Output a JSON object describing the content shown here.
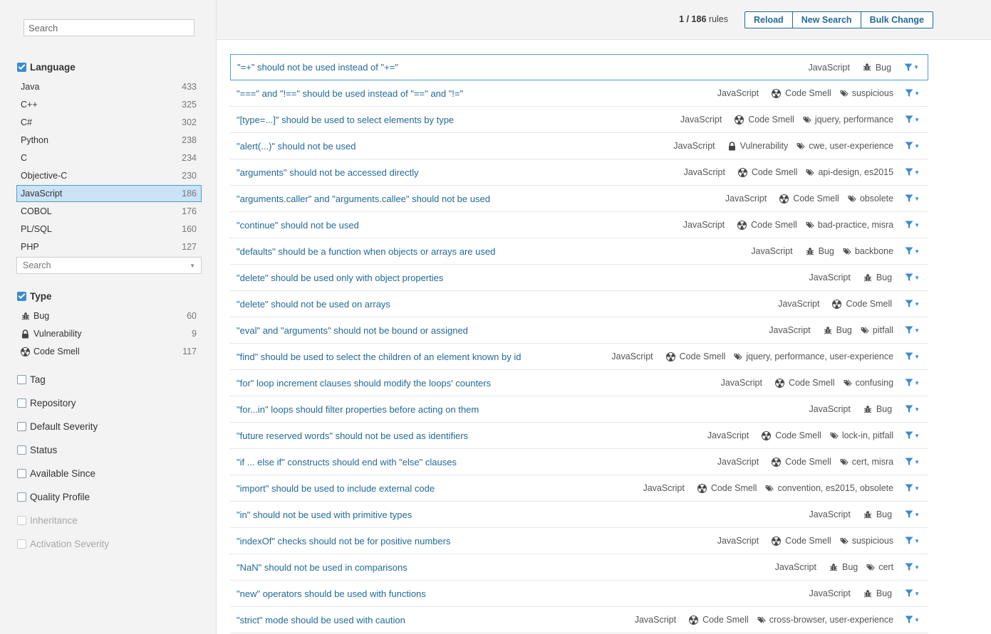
{
  "sidebar": {
    "search_placeholder": "Search",
    "language": {
      "title": "Language",
      "items": [
        {
          "label": "Java",
          "count": "433"
        },
        {
          "label": "C++",
          "count": "325"
        },
        {
          "label": "C#",
          "count": "302"
        },
        {
          "label": "Python",
          "count": "238"
        },
        {
          "label": "C",
          "count": "234"
        },
        {
          "label": "Objective-C",
          "count": "230"
        },
        {
          "label": "JavaScript",
          "count": "186"
        },
        {
          "label": "COBOL",
          "count": "176"
        },
        {
          "label": "PL/SQL",
          "count": "160"
        },
        {
          "label": "PHP",
          "count": "127"
        }
      ],
      "select_placeholder": "Search"
    },
    "type": {
      "title": "Type",
      "items": [
        {
          "label": "Bug",
          "count": "60",
          "icon": "bug-icon"
        },
        {
          "label": "Vulnerability",
          "count": "9",
          "icon": "lock-icon"
        },
        {
          "label": "Code Smell",
          "count": "117",
          "icon": "radiation-icon"
        }
      ]
    },
    "facets": {
      "tag": "Tag",
      "repository": "Repository",
      "default_severity": "Default Severity",
      "status": "Status",
      "available_since": "Available Since",
      "quality_profile": "Quality Profile",
      "inheritance": "Inheritance",
      "activation_severity": "Activation Severity"
    }
  },
  "topbar": {
    "counter_current": "1",
    "counter_total": "/ 186",
    "counter_suffix": "rules",
    "reload": "Reload",
    "new_search": "New Search",
    "bulk_change": "Bulk Change"
  },
  "rules": [
    {
      "name": "\"=+\" should not be used instead of \"+=\"",
      "lang": "JavaScript",
      "type": "Bug",
      "tags": ""
    },
    {
      "name": "\"===\" and \"!==\" should be used instead of \"==\" and \"!=\"",
      "lang": "JavaScript",
      "type": "Code Smell",
      "tags": "suspicious"
    },
    {
      "name": "\"[type=...]\" should be used to select elements by type",
      "lang": "JavaScript",
      "type": "Code Smell",
      "tags": "jquery, performance"
    },
    {
      "name": "\"alert(...)\" should not be used",
      "lang": "JavaScript",
      "type": "Vulnerability",
      "tags": "cwe, user-experience"
    },
    {
      "name": "\"arguments\" should not be accessed directly",
      "lang": "JavaScript",
      "type": "Code Smell",
      "tags": "api-design, es2015"
    },
    {
      "name": "\"arguments.caller\" and \"arguments.callee\" should not be used",
      "lang": "JavaScript",
      "type": "Code Smell",
      "tags": "obsolete"
    },
    {
      "name": "\"continue\" should not be used",
      "lang": "JavaScript",
      "type": "Code Smell",
      "tags": "bad-practice, misra"
    },
    {
      "name": "\"defaults\" should be a function when objects or arrays are used",
      "lang": "JavaScript",
      "type": "Bug",
      "tags": "backbone"
    },
    {
      "name": "\"delete\" should be used only with object properties",
      "lang": "JavaScript",
      "type": "Bug",
      "tags": ""
    },
    {
      "name": "\"delete\" should not be used on arrays",
      "lang": "JavaScript",
      "type": "Code Smell",
      "tags": ""
    },
    {
      "name": "\"eval\" and \"arguments\" should not be bound or assigned",
      "lang": "JavaScript",
      "type": "Bug",
      "tags": "pitfall"
    },
    {
      "name": "\"find\" should be used to select the children of an element known by id",
      "lang": "JavaScript",
      "type": "Code Smell",
      "tags": "jquery, performance, user-experience"
    },
    {
      "name": "\"for\" loop increment clauses should modify the loops' counters",
      "lang": "JavaScript",
      "type": "Code Smell",
      "tags": "confusing"
    },
    {
      "name": "\"for...in\" loops should filter properties before acting on them",
      "lang": "JavaScript",
      "type": "Bug",
      "tags": ""
    },
    {
      "name": "\"future reserved words\" should not be used as identifiers",
      "lang": "JavaScript",
      "type": "Code Smell",
      "tags": "lock-in, pitfall"
    },
    {
      "name": "\"if ... else if\" constructs should end with \"else\" clauses",
      "lang": "JavaScript",
      "type": "Code Smell",
      "tags": "cert, misra"
    },
    {
      "name": "\"import\" should be used to include external code",
      "lang": "JavaScript",
      "type": "Code Smell",
      "tags": "convention, es2015, obsolete"
    },
    {
      "name": "\"in\" should not be used with primitive types",
      "lang": "JavaScript",
      "type": "Bug",
      "tags": ""
    },
    {
      "name": "\"indexOf\" checks should not be for positive numbers",
      "lang": "JavaScript",
      "type": "Code Smell",
      "tags": "suspicious"
    },
    {
      "name": "\"NaN\" should not be used in comparisons",
      "lang": "JavaScript",
      "type": "Bug",
      "tags": "cert"
    },
    {
      "name": "\"new\" operators should be used with functions",
      "lang": "JavaScript",
      "type": "Bug",
      "tags": ""
    },
    {
      "name": "\"strict\" mode should be used with caution",
      "lang": "JavaScript",
      "type": "Code Smell",
      "tags": "cross-browser, user-experience"
    }
  ],
  "colors": {
    "link": "#236a97",
    "accent": "#3b8bd1",
    "selected_bg": "#cae3f7"
  }
}
